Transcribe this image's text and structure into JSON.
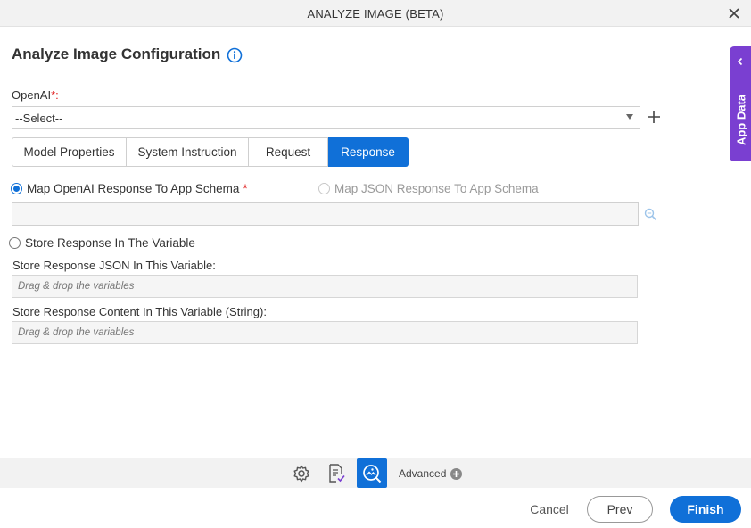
{
  "window": {
    "title": "ANALYZE IMAGE (BETA)"
  },
  "heading": {
    "title": "Analyze Image Configuration"
  },
  "openai": {
    "label": "OpenAI",
    "required_mark": "*:",
    "selected": "--Select--"
  },
  "tabs": [
    {
      "label": "Model Properties",
      "active": false
    },
    {
      "label": "System Instruction",
      "active": false
    },
    {
      "label": "Request",
      "active": false
    },
    {
      "label": "Response",
      "active": true
    }
  ],
  "response": {
    "map_openai_label": "Map OpenAI Response To App Schema",
    "map_openai_required": "*",
    "map_json_label": "Map JSON Response To App Schema",
    "store_variable_label": "Store Response In The Variable",
    "json_var_label": "Store Response JSON In This Variable:",
    "json_var_placeholder": "Drag & drop the variables",
    "content_var_label": "Store Response Content In This Variable (String):",
    "content_var_placeholder": "Drag & drop the variables"
  },
  "side_panel": {
    "label": "App Data"
  },
  "toolbar": {
    "advanced_label": "Advanced"
  },
  "footer": {
    "cancel": "Cancel",
    "prev": "Prev",
    "finish": "Finish"
  },
  "colors": {
    "accent": "#1070d8",
    "side_panel": "#7a3fd1",
    "required": "#e02424"
  }
}
